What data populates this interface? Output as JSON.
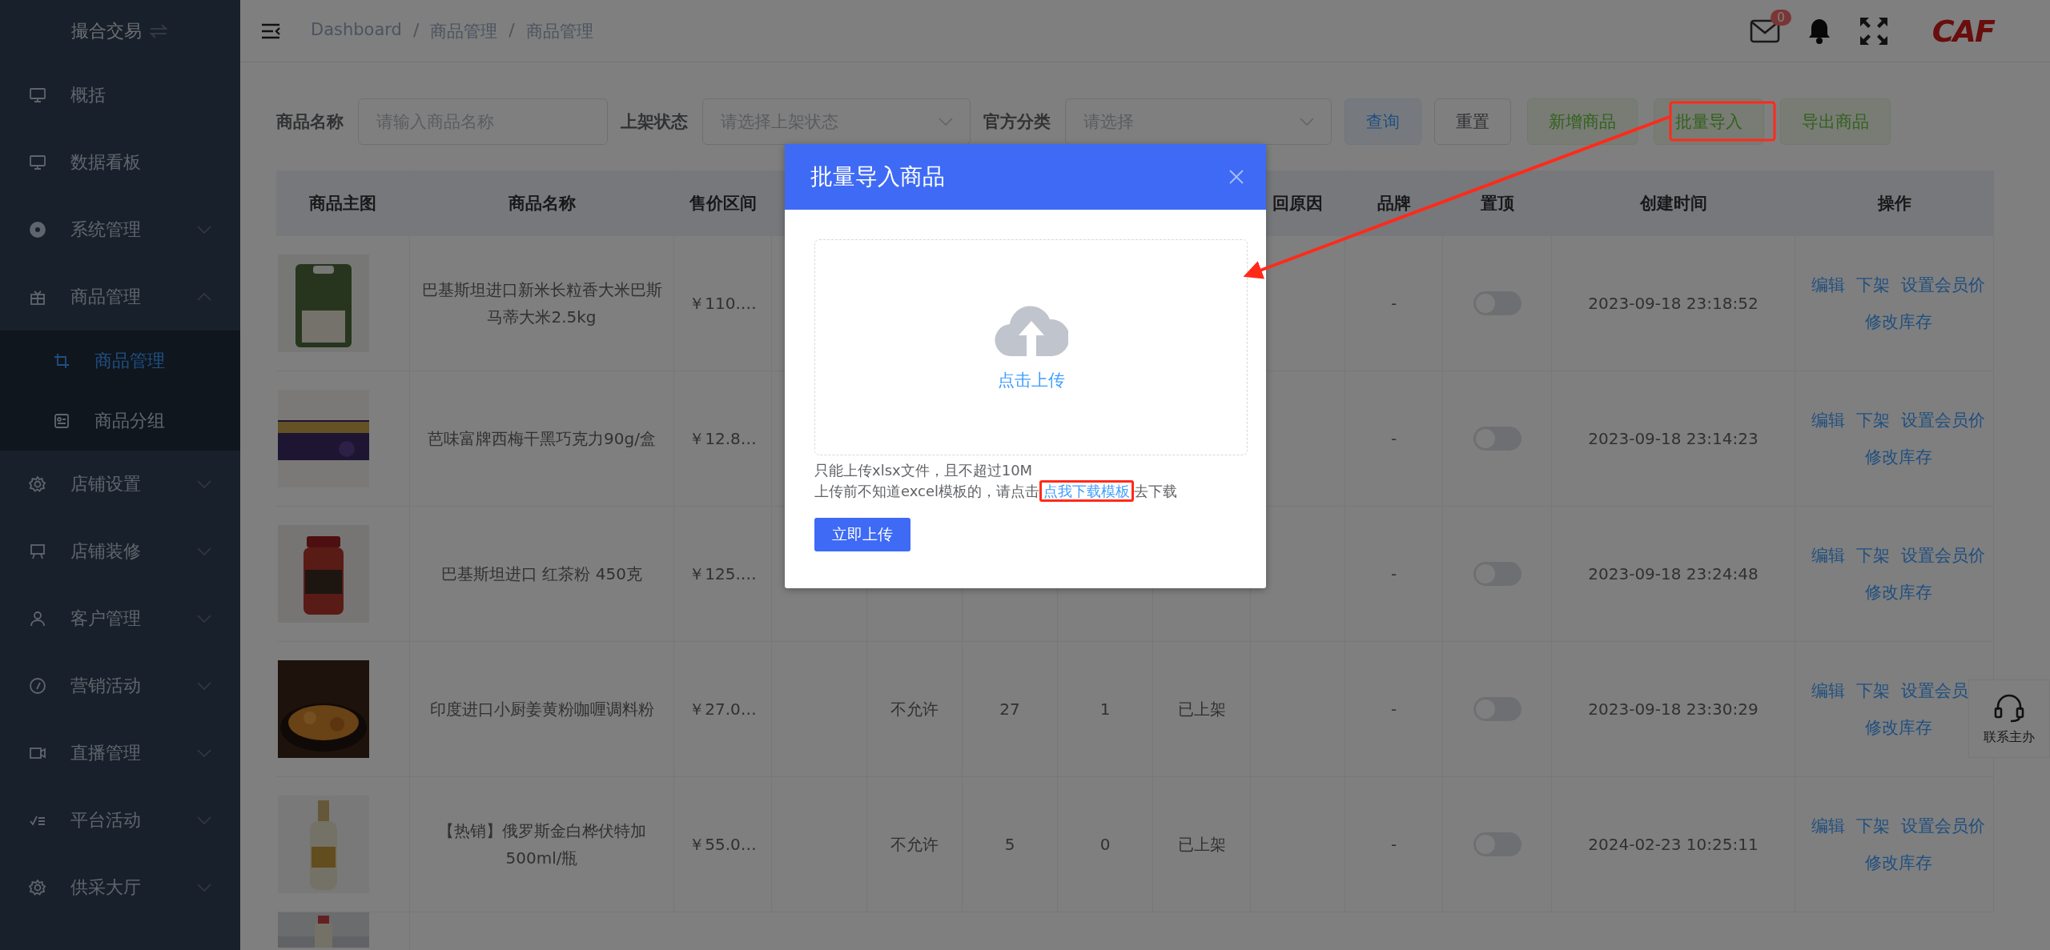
{
  "sidebar": {
    "title": "撮合交易",
    "items": [
      {
        "label": "概括"
      },
      {
        "label": "数据看板"
      },
      {
        "label": "系统管理",
        "expanded": false
      },
      {
        "label": "商品管理",
        "expanded": true,
        "children": [
          {
            "label": "商品管理",
            "selected": true
          },
          {
            "label": "商品分组",
            "selected": false
          }
        ]
      },
      {
        "label": "店铺设置",
        "expanded": false
      },
      {
        "label": "店铺装修",
        "expanded": false
      },
      {
        "label": "客户管理",
        "expanded": false
      },
      {
        "label": "营销活动",
        "expanded": false
      },
      {
        "label": "直播管理",
        "expanded": false
      },
      {
        "label": "平台活动",
        "expanded": false
      },
      {
        "label": "供采大厅",
        "expanded": false
      }
    ]
  },
  "navbar": {
    "breadcrumb": [
      "Dashboard",
      "商品管理",
      "商品管理"
    ],
    "separator": "/",
    "mail_badge": "0",
    "logo": "CAF"
  },
  "filters": [
    {
      "label": "商品名称",
      "placeholder": "请输入商品名称",
      "kind": "input"
    },
    {
      "label": "上架状态",
      "placeholder": "请选择上架状态",
      "kind": "select"
    },
    {
      "label": "官方分类",
      "placeholder": "请选择",
      "kind": "select"
    }
  ],
  "buttons": [
    {
      "label": "查询",
      "kind": "primary"
    },
    {
      "label": "重置",
      "kind": "default"
    },
    {
      "label": "新增商品",
      "kind": "success"
    },
    {
      "label": "批量导入",
      "kind": "success"
    },
    {
      "label": "导出商品",
      "kind": "success"
    }
  ],
  "table": {
    "columns": [
      {
        "label": "商品主图"
      },
      {
        "label": "商品名称"
      },
      {
        "label": "售价区间"
      },
      {},
      {},
      {},
      {},
      {},
      {
        "label": "回原因"
      },
      {
        "label": "品牌"
      },
      {
        "label": "置顶"
      },
      {
        "label": "创建时间"
      },
      {
        "label": "操作"
      }
    ],
    "rows": [
      {
        "name": "巴基斯坦进口新米长粒香大米巴斯马蒂大米2.5kg",
        "price": "￥110.…",
        "brand": "-",
        "pinned": false,
        "created": "2023-09-18 23:18:52",
        "actions": [
          "编辑",
          "下架",
          "设置会员价",
          "修改库存"
        ]
      },
      {
        "name": "芭味富牌西梅干黑巧克力90g/盒",
        "price": "￥12.8…",
        "brand": "-",
        "pinned": false,
        "created": "2023-09-18 23:14:23",
        "actions": [
          "编辑",
          "下架",
          "设置会员价",
          "修改库存"
        ]
      },
      {
        "name": "巴基斯坦进口 红茶粉 450克",
        "price": "￥125.…",
        "brand": "-",
        "pinned": false,
        "created": "2023-09-18 23:24:48",
        "actions": [
          "编辑",
          "下架",
          "设置会员价",
          "修改库存"
        ]
      },
      {
        "name": "印度进口小厨姜黄粉咖喱调料粉",
        "price": "￥27.0…",
        "column_5": "不允许",
        "column_6": "27",
        "column_7": "1",
        "column_8": "已上架",
        "brand": "-",
        "pinned": false,
        "created": "2023-09-18 23:30:29",
        "actions": [
          "编辑",
          "下架",
          "设置会员",
          "修改库存"
        ]
      },
      {
        "name": "【热销】俄罗斯金白桦伏特加 500ml/瓶",
        "price": "￥55.0…",
        "column_5": "不允许",
        "column_6": "5",
        "column_7": "0",
        "column_8": "已上架",
        "brand": "-",
        "pinned": false,
        "created": "2024-02-23 10:25:11",
        "actions": [
          "编辑",
          "下架",
          "设置会员价",
          "修改库存"
        ]
      },
      {
        "kind": "picture"
      }
    ]
  },
  "contact": {
    "label": "联系主办"
  },
  "dialog": {
    "title": "批量导入商品",
    "upload_label": "点击上传",
    "tip": "只能上传xlsx文件，且不超过10M",
    "hint_before": "上传前不知道excel模板的，请点击",
    "hint_link": "点我下载模板",
    "hint_after": "去下载",
    "submit": "立即上传"
  }
}
